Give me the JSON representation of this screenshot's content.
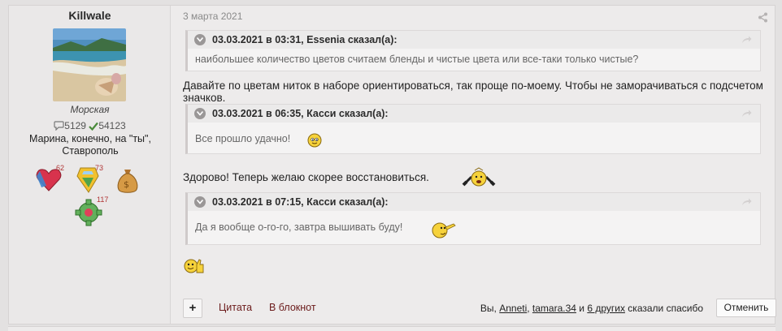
{
  "user": {
    "name": "Killwale",
    "title": "Морская",
    "messages": "5129",
    "likes": "54123",
    "status": "Марина, конечно, на \"ты\", Ставрополь",
    "awards": [
      {
        "icon": "heart-award-icon",
        "count": "62"
      },
      {
        "icon": "gem-award-icon",
        "count": "73"
      },
      {
        "icon": "money-bag-award-icon",
        "count": ""
      },
      {
        "icon": "gear-award-icon",
        "count": "117"
      }
    ]
  },
  "post": {
    "date": "3 марта 2021",
    "quotes": [
      {
        "header": "03.03.2021 в 03:31, Essenia сказал(а):",
        "body": "наибольшее количество цветов считаем бленды и чистые цвета или все-таки только чистые?"
      },
      {
        "header": "03.03.2021 в 06:35, Касси сказал(а):",
        "body": "Все прошло удачно!"
      },
      {
        "header": "03.03.2021 в 07:15, Касси сказал(а):",
        "body": "Да я вообще о-го-го, завтра вышивать буду!"
      }
    ],
    "text1": "Давайте по цветам ниток в наборе ориентироваться, так проще по-моему. Чтобы не заморачиваться с подсчетом значков.",
    "text2": "Здорово! Теперь желаю скорее восстановиться."
  },
  "actions": {
    "plus": "+",
    "quote": "Цитата",
    "notebook": "В блокнот",
    "likes_prefix": "Вы, ",
    "liker1": "Anneti",
    "sep": ", ",
    "liker2": "tamara.34",
    "and": " и ",
    "others": "6 других",
    "likes_suffix": " сказали спасибо",
    "cancel": "Отменить"
  },
  "colors": {
    "accent_link": "#6b1b1b",
    "background": "#edebeb"
  }
}
